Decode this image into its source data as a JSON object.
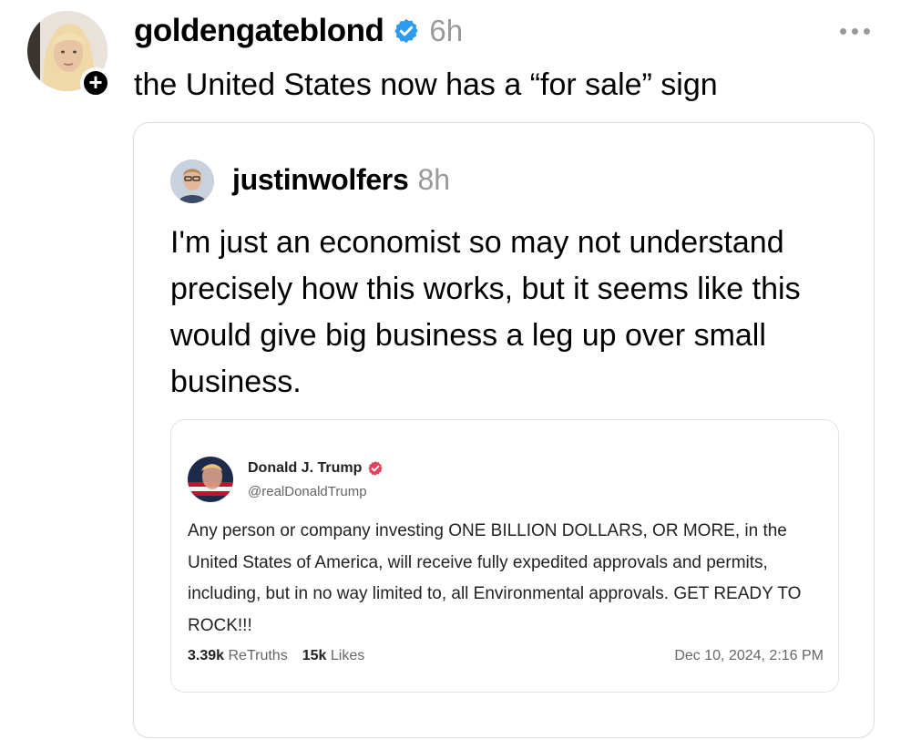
{
  "post": {
    "username": "goldengateblond",
    "time": "6h",
    "text": "the United States now has a “for sale” sign",
    "icons": {
      "verified": "verified-check-icon",
      "more": "more-horizontal-icon",
      "follow": "plus-icon"
    },
    "colors": {
      "verified": "#2f9bf0",
      "time": "#999999",
      "border": "#dddddd"
    }
  },
  "quote": {
    "username": "justinwolfers",
    "time": "8h",
    "text": "I'm just an economist so may not understand precisely how this works, but it seems like this would give big business a leg up over small business."
  },
  "embed": {
    "name": "Donald J. Trump",
    "handle": "@realDonaldTrump",
    "text": "Any person or company investing ONE BILLION DOLLARS, OR MORE, in the United States of America, will receive fully expedited approvals and permits, including, but in no way limited to, all Environmental approvals. GET READY TO ROCK!!!",
    "retruths_count": "3.39k",
    "retruths_label": "ReTruths",
    "likes_count": "15k",
    "likes_label": "Likes",
    "date": "Dec 10, 2024, 2:16 PM",
    "colors": {
      "verified": "#e4405f"
    }
  }
}
